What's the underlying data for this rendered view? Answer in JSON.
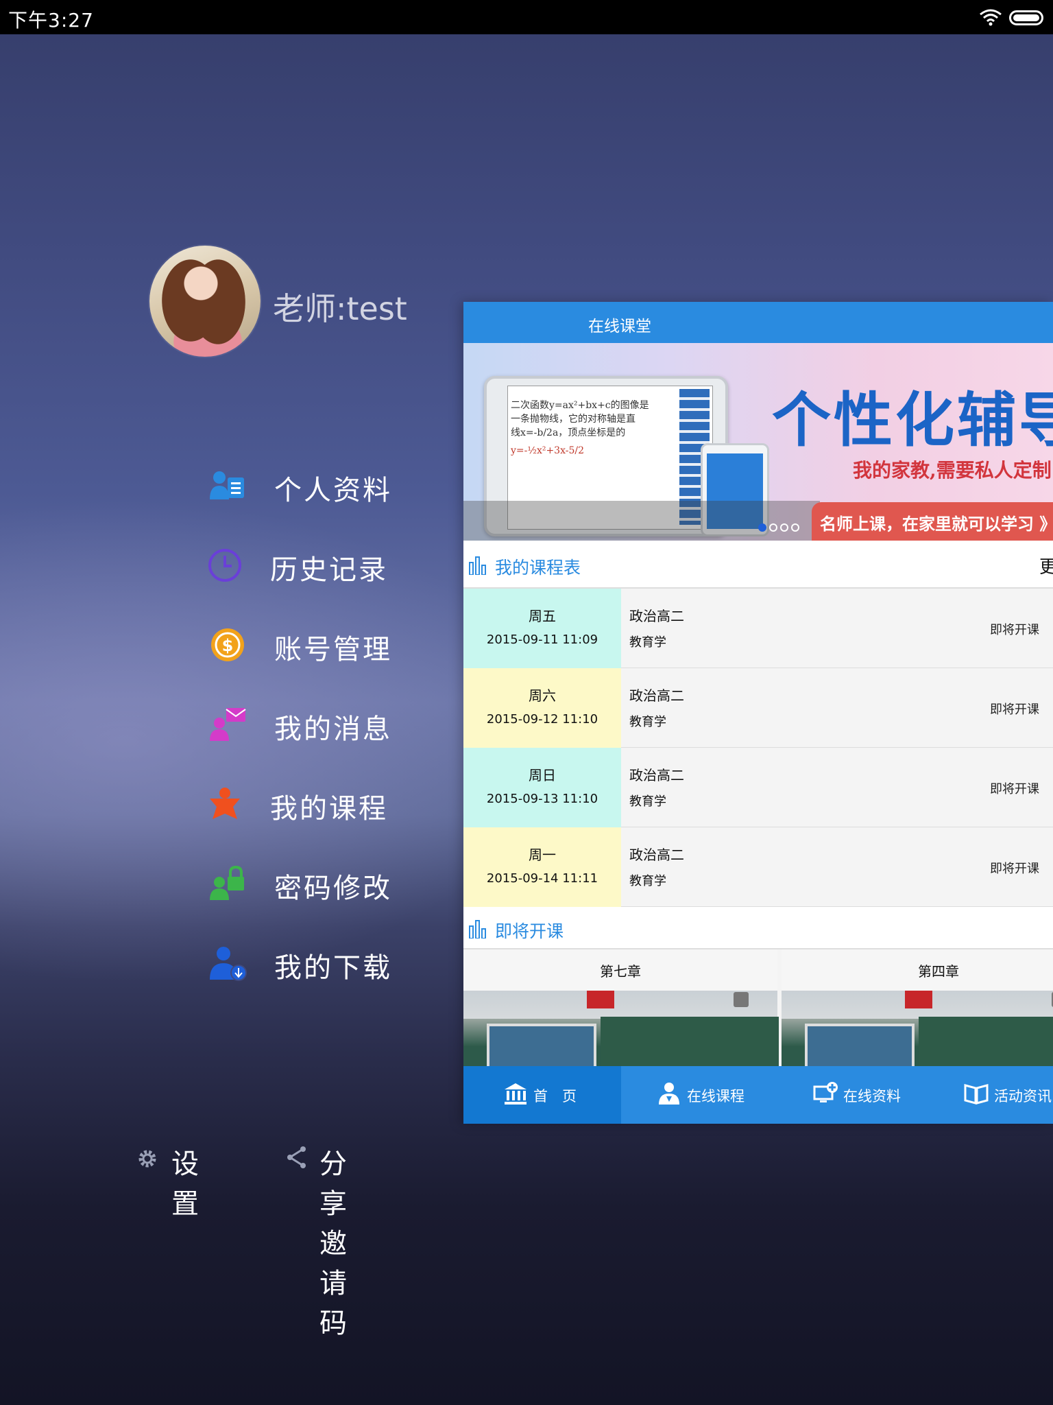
{
  "status_bar": {
    "time": "下午3:27"
  },
  "profile": {
    "name": "老师:test"
  },
  "menu": [
    {
      "label": "个人资料",
      "icon": "profile-card-icon",
      "color": "#2a8be0"
    },
    {
      "label": "历史记录",
      "icon": "clock-icon",
      "color": "#6a3fd8"
    },
    {
      "label": "账号管理",
      "icon": "dollar-coin-icon",
      "color": "#f2a21b"
    },
    {
      "label": "我的消息",
      "icon": "message-icon",
      "color": "#d43bc9"
    },
    {
      "label": "我的课程",
      "icon": "course-icon",
      "color": "#f0501e"
    },
    {
      "label": "密码修改",
      "icon": "lock-user-icon",
      "color": "#3cb54a"
    },
    {
      "label": "我的下载",
      "icon": "download-user-icon",
      "color": "#1e5fd9"
    }
  ],
  "footer": {
    "settings": "设置",
    "share": "分享邀请码"
  },
  "app": {
    "title": "在线课堂",
    "banner": {
      "headline": "个性化辅导",
      "subline": "我的家教,需要私人定制",
      "ribbon": "名师上课，在家里就可以学习 》",
      "formula_lines": [
        "二次函数y=ax²+bx+c的图像是",
        "一条抛物线，它的对称轴是直",
        "线x=-b/2a，顶点坐标是的",
        "y=-½x²+3x-5/2"
      ]
    },
    "schedule": {
      "title": "我的课程表",
      "more": "更",
      "rows": [
        {
          "day": "周五",
          "date": "2015-09-11 11:09",
          "name": "政治高二",
          "subject": "教育学",
          "state": "即将开课",
          "color": "#c8f7ef"
        },
        {
          "day": "周六",
          "date": "2015-09-12 11:10",
          "name": "政治高二",
          "subject": "教育学",
          "state": "即将开课",
          "color": "#fdf9c8"
        },
        {
          "day": "周日",
          "date": "2015-09-13 11:10",
          "name": "政治高二",
          "subject": "教育学",
          "state": "即将开课",
          "color": "#c8f7ef"
        },
        {
          "day": "周一",
          "date": "2015-09-14 11:11",
          "name": "政治高二",
          "subject": "教育学",
          "state": "即将开课",
          "color": "#fdf9c8"
        }
      ]
    },
    "upcoming": {
      "title": "即将开课",
      "cards": [
        {
          "title": "第七章"
        },
        {
          "title": "第四章"
        }
      ]
    },
    "tabs": [
      {
        "label": "首　页",
        "icon": "home-bank-icon",
        "active": true
      },
      {
        "label": "在线课程",
        "icon": "teacher-icon",
        "active": false
      },
      {
        "label": "在线资料",
        "icon": "monitor-plus-icon",
        "active": false
      },
      {
        "label": "活动资讯",
        "icon": "book-icon",
        "active": false
      }
    ]
  }
}
